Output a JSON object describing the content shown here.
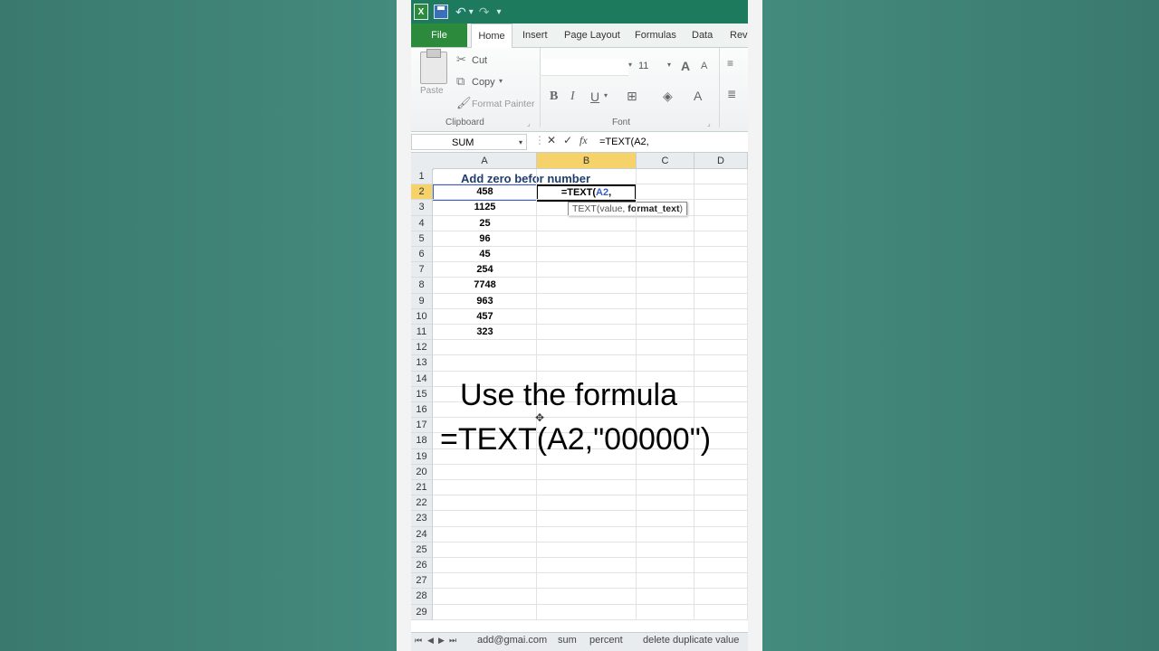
{
  "titlebar": {
    "app_icon": "excel-icon",
    "qa_icons": [
      "save-icon",
      "undo-icon",
      "redo-icon"
    ]
  },
  "tabs": [
    "File",
    "Home",
    "Insert",
    "Page Layout",
    "Formulas",
    "Data",
    "Revi"
  ],
  "ribbon": {
    "paste": "Paste",
    "cut": "Cut",
    "copy": "Copy",
    "format_painter": "Format Painter",
    "clipboard_group": "Clipboard",
    "font_size": "11",
    "font_group": "Font",
    "bold": "B",
    "italic": "I",
    "underline": "U",
    "grow_font": "A",
    "shrink_font": "A",
    "font_color": "A"
  },
  "formula_bar": {
    "name_box": "SUM",
    "fx": "fx",
    "formula": "=TEXT(A2,"
  },
  "columns": [
    "A",
    "B",
    "C",
    "D"
  ],
  "rows": [
    "1",
    "2",
    "3",
    "4",
    "5",
    "6",
    "7",
    "8",
    "9",
    "10",
    "11",
    "12",
    "13",
    "14",
    "15",
    "16",
    "17",
    "18",
    "19",
    "20",
    "21",
    "22",
    "23",
    "24",
    "25",
    "26",
    "27",
    "28",
    "29"
  ],
  "sheet": {
    "title": "Add zero befor number",
    "values": [
      "458",
      "1125",
      "25",
      "96",
      "45",
      "254",
      "7748",
      "963",
      "457",
      "323"
    ],
    "b2_prefix": "=TEXT(",
    "b2_ref": "A2",
    "b2_suffix": ",",
    "tooltip_fn": "TEXT(value, ",
    "tooltip_arg": "format_text",
    "tooltip_end": ")"
  },
  "sheet_tabs": [
    "add@gmai.com",
    "sum",
    "percent",
    "delete duplicate value"
  ],
  "caption": {
    "line1": "Use the formula",
    "line2": "=TEXT(A2,\"00000\")"
  },
  "colors": {
    "excel_green": "#1e7a5d",
    "file_tab": "#2c8a3c",
    "header_active": "#f5d36a",
    "background": "#3e7f73"
  }
}
